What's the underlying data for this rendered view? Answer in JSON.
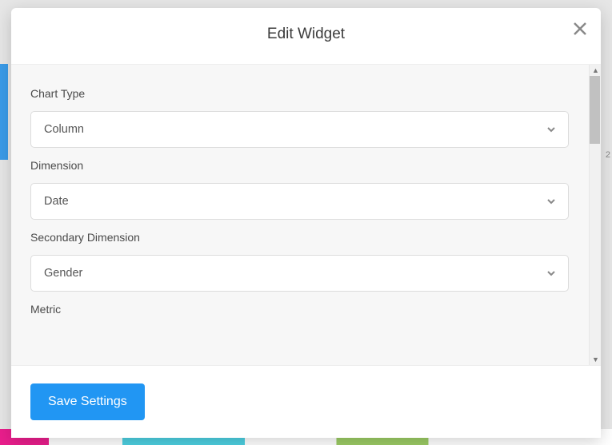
{
  "backdrop": {
    "num": "2"
  },
  "modal": {
    "title": "Edit Widget",
    "fields": {
      "chart_type": {
        "label": "Chart Type",
        "value": "Column"
      },
      "dimension": {
        "label": "Dimension",
        "value": "Date"
      },
      "secondary_dimension": {
        "label": "Secondary Dimension",
        "value": "Gender"
      },
      "metric": {
        "label": "Metric"
      }
    },
    "save_label": "Save Settings"
  }
}
